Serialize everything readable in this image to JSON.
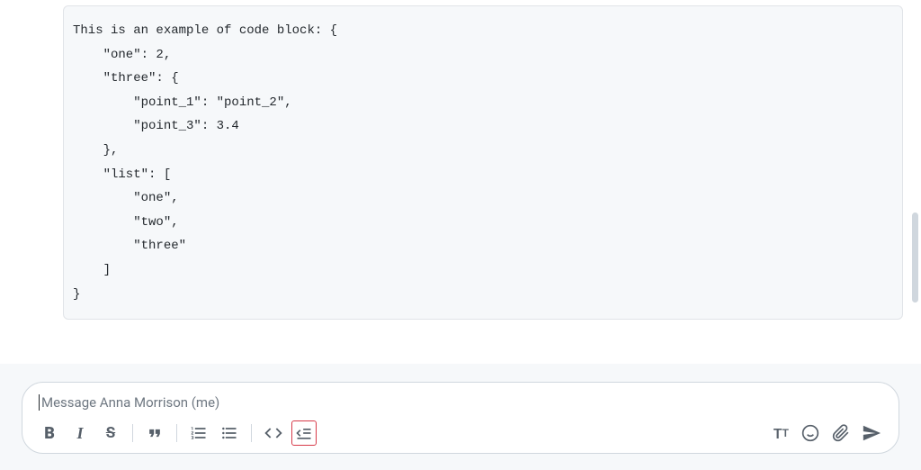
{
  "code_block": {
    "content": "This is an example of code block: {\n    \"one\": 2,\n    \"three\": {\n        \"point_1\": \"point_2\",\n        \"point_3\": 3.4\n    },\n    \"list\": [\n        \"one\",\n        \"two\",\n        \"three\"\n    ]\n}"
  },
  "composer": {
    "placeholder": "Message Anna Morrison (me)"
  },
  "toolbar": {
    "bold": "B",
    "italic": "I",
    "strike": "S",
    "quote": "quote",
    "ordered_list": "ordered-list",
    "unordered_list": "unordered-list",
    "code_inline": "code",
    "code_block": "code-block",
    "text_format": "Tt",
    "emoji": "emoji",
    "attach": "attach",
    "send": "send"
  }
}
